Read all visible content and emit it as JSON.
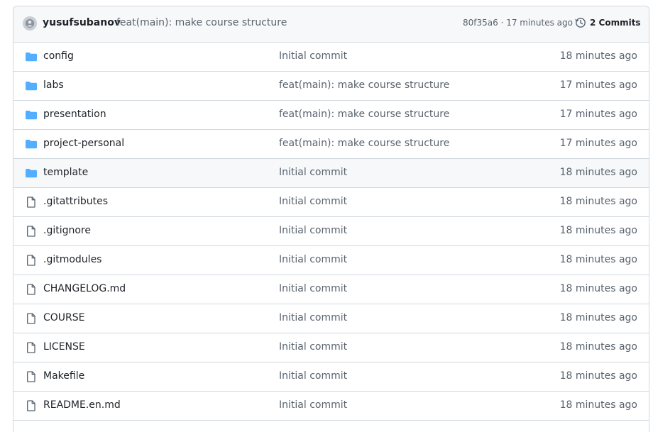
{
  "header": {
    "author": "yusufsubanov",
    "message": "feat(main): make course structure",
    "hash_time": "80f35a6 · 17 minutes ago",
    "commits_label": "2 Commits"
  },
  "files": [
    {
      "type": "folder",
      "name": "config",
      "message": "Initial commit",
      "time": "18 minutes ago"
    },
    {
      "type": "folder",
      "name": "labs",
      "message": "feat(main): make course structure",
      "time": "17 minutes ago"
    },
    {
      "type": "folder",
      "name": "presentation",
      "message": "feat(main): make course structure",
      "time": "17 minutes ago"
    },
    {
      "type": "folder",
      "name": "project-personal",
      "message": "feat(main): make course structure",
      "time": "17 minutes ago"
    },
    {
      "type": "folder",
      "name": "template",
      "message": "Initial commit",
      "time": "18 minutes ago"
    },
    {
      "type": "file",
      "name": ".gitattributes",
      "message": "Initial commit",
      "time": "18 minutes ago"
    },
    {
      "type": "file",
      "name": ".gitignore",
      "message": "Initial commit",
      "time": "18 minutes ago"
    },
    {
      "type": "file",
      "name": ".gitmodules",
      "message": "Initial commit",
      "time": "18 minutes ago"
    },
    {
      "type": "file",
      "name": "CHANGELOG.md",
      "message": "Initial commit",
      "time": "18 minutes ago"
    },
    {
      "type": "file",
      "name": "COURSE",
      "message": "Initial commit",
      "time": "18 minutes ago"
    },
    {
      "type": "file",
      "name": "LICENSE",
      "message": "Initial commit",
      "time": "18 minutes ago"
    },
    {
      "type": "file",
      "name": "Makefile",
      "message": "Initial commit",
      "time": "18 minutes ago"
    },
    {
      "type": "file",
      "name": "README.en.md",
      "message": "Initial commit",
      "time": "18 minutes ago"
    }
  ],
  "colors": {
    "folder_icon": "#54aeff",
    "file_icon": "#59636e",
    "border": "#d0d7de",
    "header_bg": "#f6f8fa"
  }
}
